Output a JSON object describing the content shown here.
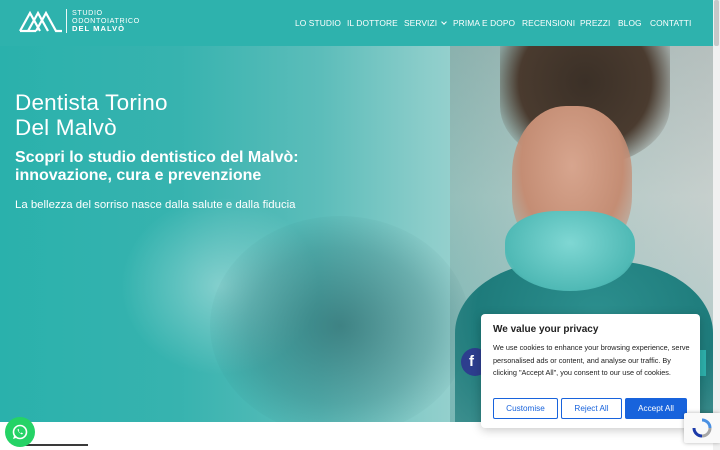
{
  "header": {
    "logo": {
      "line1": "STUDIO",
      "line2": "ODONTOIATRICO",
      "line3": "DEL MALVÒ",
      "icon": "studio-logo-icon"
    },
    "nav": [
      {
        "label": "LO STUDIO"
      },
      {
        "label": "IL DOTTORE"
      },
      {
        "label": "SERVIZI",
        "has_dropdown": true
      },
      {
        "label": "PRIMA E DOPO"
      },
      {
        "label": "RECENSIONI"
      },
      {
        "label": "PREZZI"
      },
      {
        "label": "BLOG"
      },
      {
        "label": "CONTATTI"
      }
    ]
  },
  "hero": {
    "title_line1": "Dentista Torino",
    "title_line2": "Del Malvò",
    "subtitle_line1": "Scopri lo studio dentistico del Malvò:",
    "subtitle_line2": "innovazione, cura e prevenzione",
    "tagline": "La bellezza del sorriso nasce dalla salute e dalla fiducia"
  },
  "social": {
    "facebook_icon": "facebook-icon"
  },
  "floating": {
    "whatsapp_icon": "whatsapp-icon",
    "recaptcha_icon": "recaptcha-icon"
  },
  "cookie_banner": {
    "title": "We value your privacy",
    "body": "We use cookies to enhance your browsing experience, serve personalised ads or content, and analyse our traffic. By clicking \"Accept All\", you consent to our use of cookies.",
    "customise_label": "Customise",
    "reject_label": "Reject All",
    "accept_label": "Accept All"
  },
  "colors": {
    "brand_teal": "#2eb2ad",
    "cookie_blue": "#1863dc",
    "whatsapp_green": "#25d366",
    "facebook_blue": "#2d3e8e"
  }
}
